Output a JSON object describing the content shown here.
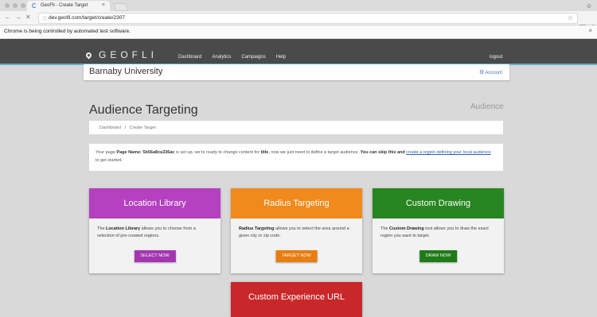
{
  "browser": {
    "tab_title": "GeoFli - Create Target",
    "tab_close": "×",
    "url": "dev.geofli.com/target/create/2307",
    "infobar_text": "Chrome is being controlled by automated test software.",
    "infobar_close": "×"
  },
  "header": {
    "logo": "GEOFLI",
    "nav": [
      "Dashboard",
      "Analytics",
      "Campaigns",
      "Help"
    ],
    "logout": "logout"
  },
  "org": {
    "name": "Barnaby University",
    "account": "Account"
  },
  "page": {
    "title": "Audience Targeting",
    "section": "Audience",
    "breadcrumb": [
      "Dashboard",
      "/",
      "Create Target"
    ]
  },
  "notice": {
    "t1": "Your page ",
    "b1": "Page Name: 5b56a8ca336ac",
    "t2": " is set up, we're ready to change content for ",
    "b2": "title",
    "t3": ", now we just need to define a target audience. ",
    "b3": "You can skip this and",
    "link": "create a region defining your local audience",
    "t4": " to get started."
  },
  "cards": [
    {
      "title": "Location Library",
      "bold": "Location Library",
      "rest": " allows you to choose from a selection of pre-created regions.",
      "button": "SELECT NOW"
    },
    {
      "title": "Radius Targeting",
      "bold": "Radius Targeting",
      "rest": " allows you to select the area around a given city or zip code.",
      "button": "TARGET NOW"
    },
    {
      "title": "Custom Drawing",
      "bold": "Custom Drawing",
      "rest": " tool allows you to draw the exact region you want to target.",
      "button": "DRAW NOW"
    },
    {
      "title": "Custom Experience URL"
    }
  ],
  "colors": {
    "header_bg": "#4a4a4a",
    "header_accent": "#5fb4c8",
    "location_library": "#b540c0",
    "radius_targeting": "#f08a1c",
    "custom_drawing": "#27861f",
    "custom_experience": "#c8282a"
  },
  "icons": [
    "map-pin-icon",
    "gear-icon",
    "back-icon",
    "forward-icon",
    "reload-icon",
    "star-icon",
    "menu-icon",
    "profile-icon"
  ]
}
